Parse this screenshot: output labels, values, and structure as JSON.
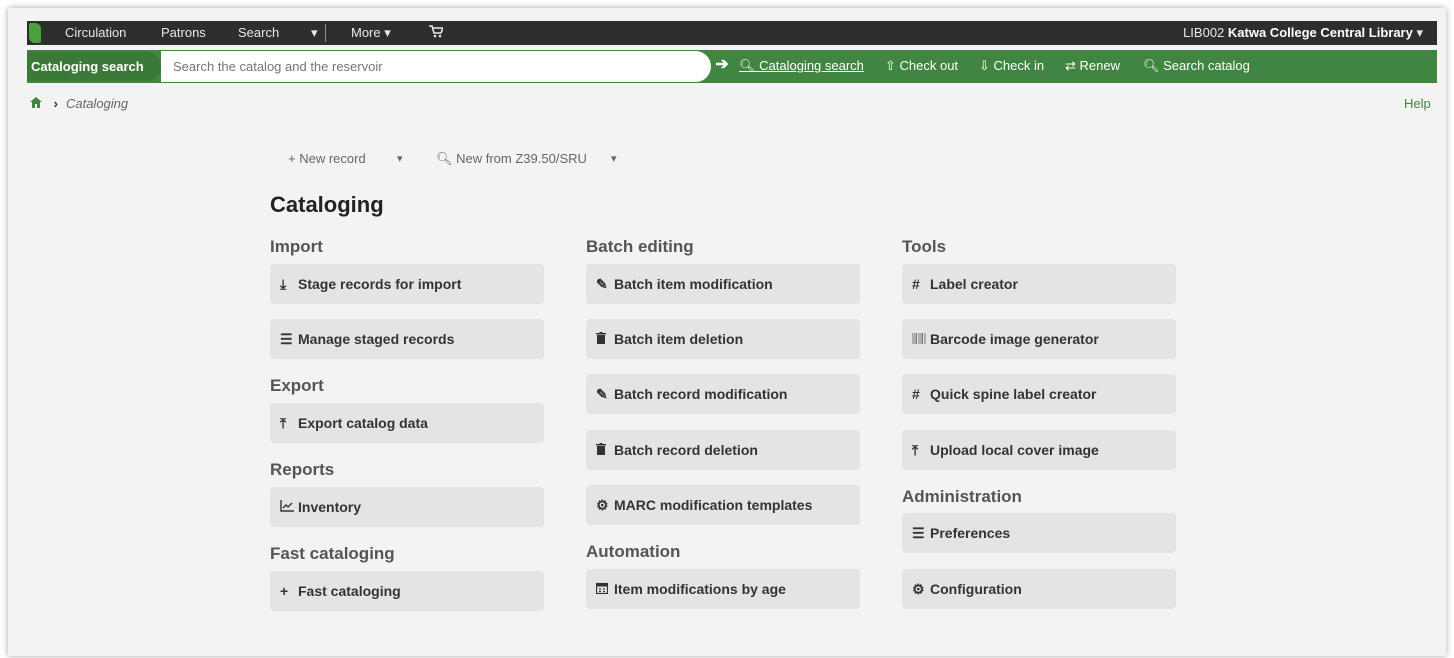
{
  "topnav": {
    "items": [
      "Circulation",
      "Patrons",
      "Search",
      "More",
      "cart-icon"
    ],
    "more_label": "More",
    "library_code": "LIB002",
    "library_name": "Katwa College Central Library"
  },
  "searchbar": {
    "label": "Cataloging search",
    "placeholder": "Search the catalog and the reservoir",
    "tools": [
      "Cataloging search",
      "Check out",
      "Check in",
      "Renew",
      "Search catalog"
    ]
  },
  "breadcrumb": {
    "current": "Cataloging",
    "help": "Help"
  },
  "toolbar": {
    "new_record": "New record",
    "new_z3950": "New from Z39.50/SRU"
  },
  "page_title": "Cataloging",
  "sections": {
    "import": "Import",
    "export": "Export",
    "reports": "Reports",
    "fast": "Fast cataloging",
    "batch": "Batch editing",
    "automation": "Automation",
    "tools": "Tools",
    "admin": "Administration"
  },
  "buttons": {
    "stage": "Stage records for import",
    "manage": "Manage staged records",
    "export": "Export catalog data",
    "inventory": "Inventory",
    "fast": "Fast cataloging",
    "batch_item_mod": "Batch item modification",
    "batch_item_del": "Batch item deletion",
    "batch_rec_mod": "Batch record modification",
    "batch_rec_del": "Batch record deletion",
    "marc_templates": "MARC modification templates",
    "item_age": "Item modifications by age",
    "label_creator": "Label creator",
    "barcode": "Barcode image generator",
    "spine": "Quick spine label creator",
    "cover": "Upload local cover image",
    "preferences": "Preferences",
    "configuration": "Configuration"
  },
  "icons": {
    "home": "home-icon",
    "download": "download-icon",
    "list": "list-icon",
    "upload": "upload-icon",
    "chart": "chart-icon",
    "plus": "plus-icon",
    "pencil": "pencil-icon",
    "trash": "trash-icon",
    "gear": "gear-icon",
    "calendar": "calendar-icon",
    "hash": "hash-icon",
    "barcode": "barcode-icon"
  },
  "colors": {
    "nav_bg": "#2e2e2e",
    "accent_green": "#408540",
    "button_bg": "#e4e4e4"
  }
}
